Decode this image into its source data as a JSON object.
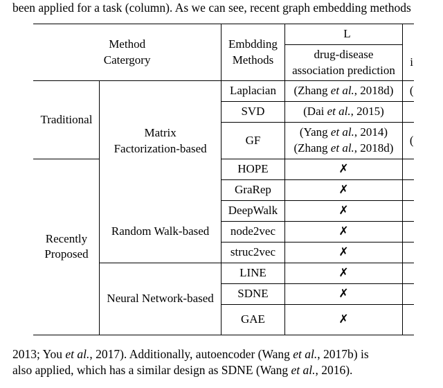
{
  "top_text": "been applied for a task (column). As we can see, recent graph embedding methods",
  "bottom_text_1": "2013; You et al., 2017). Additionally, autoencoder (Wang et al., 2017b) is",
  "bottom_text_2": "also applied, which has a similar design as SDNE (Wang et al., 2016).",
  "header": {
    "method_cat_l1": "Method",
    "method_cat_l2": "Catergory",
    "embedding_l1": "Embdding",
    "embedding_l2": "Methods",
    "L_letter": "L",
    "task_l1": "drug-disease",
    "task_l2": "association prediction",
    "i_letter": "i"
  },
  "body": {
    "trad": "Traditional",
    "mf_l1": "Matrix",
    "mf_l2": "Factorization-based",
    "recent_l1": "Recently",
    "recent_l2": "Proposed",
    "rw": "Random Walk-based",
    "nn": "Neural Network-based",
    "rows": [
      {
        "m": "Laplacian",
        "t": "(Zhang et al., 2018d)",
        "cut": "("
      },
      {
        "m": "SVD",
        "t": "(Dai et al., 2015)",
        "cut": ""
      },
      {
        "m": "GF",
        "t1": "(Yang et al., 2014)",
        "t2": "(Zhang et al., 2018d)",
        "cut": "("
      },
      {
        "m": "HOPE",
        "t": "✗",
        "cut": ""
      },
      {
        "m": "GraRep",
        "t": "✗",
        "cut": ""
      },
      {
        "m": "DeepWalk",
        "t": "✗",
        "cut": ""
      },
      {
        "m": "node2vec",
        "t": "✗",
        "cut": ""
      },
      {
        "m": "struc2vec",
        "t": "✗",
        "cut": ""
      },
      {
        "m": "LINE",
        "t": "✗",
        "cut": ""
      },
      {
        "m": "SDNE",
        "t": "✗",
        "cut": ""
      },
      {
        "m": "GAE",
        "t": "✗",
        "cut": ""
      }
    ]
  }
}
